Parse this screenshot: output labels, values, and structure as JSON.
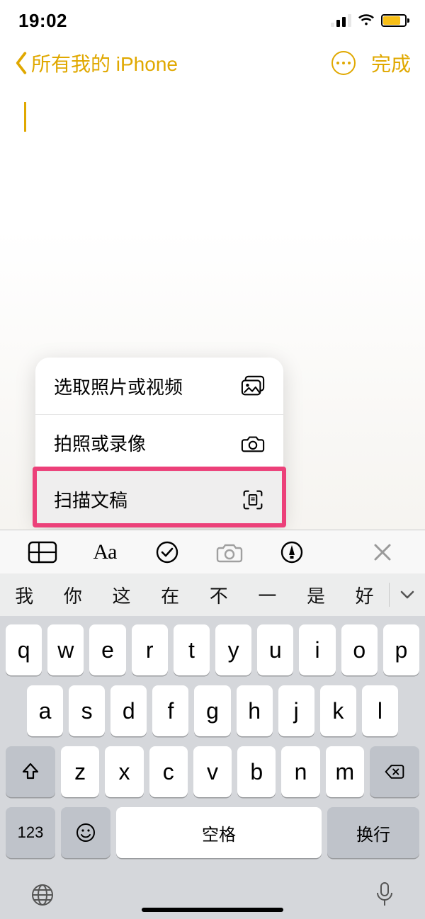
{
  "status": {
    "time": "19:02"
  },
  "nav": {
    "back_label": "所有我的 iPhone",
    "done_label": "完成"
  },
  "popup": {
    "items": [
      {
        "label": "选取照片或视频"
      },
      {
        "label": "拍照或录像"
      },
      {
        "label": "扫描文稿"
      }
    ]
  },
  "toolbar": {
    "aa": "Aa"
  },
  "suggestions": [
    "我",
    "你",
    "这",
    "在",
    "不",
    "一",
    "是",
    "好"
  ],
  "keyboard": {
    "row1": [
      "q",
      "w",
      "e",
      "r",
      "t",
      "y",
      "u",
      "i",
      "o",
      "p"
    ],
    "row2": [
      "a",
      "s",
      "d",
      "f",
      "g",
      "h",
      "j",
      "k",
      "l"
    ],
    "row3": [
      "z",
      "x",
      "c",
      "v",
      "b",
      "n",
      "m"
    ],
    "numeric": "123",
    "emoji": "😀",
    "space": "空格",
    "return": "换行"
  }
}
